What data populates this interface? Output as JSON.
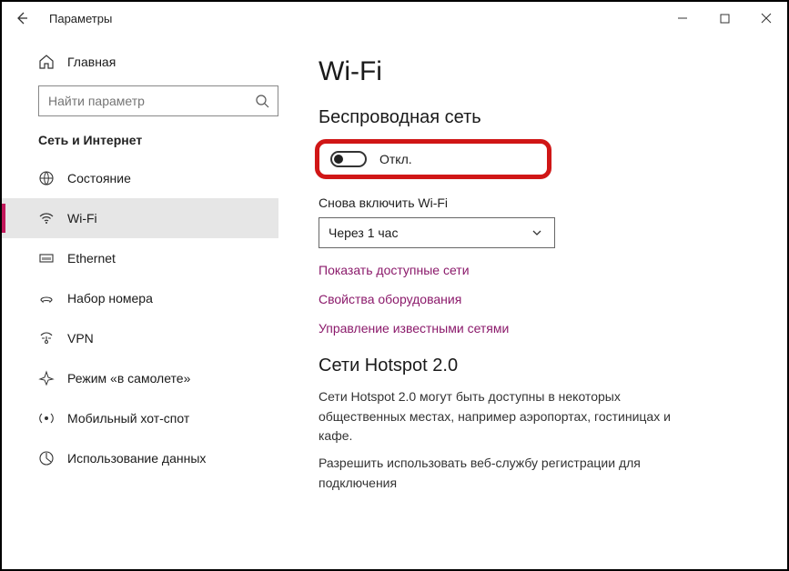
{
  "window": {
    "title": "Параметры"
  },
  "sidebar": {
    "home_label": "Главная",
    "search_placeholder": "Найти параметр",
    "category": "Сеть и Интернет",
    "items": [
      {
        "label": "Состояние"
      },
      {
        "label": "Wi-Fi"
      },
      {
        "label": "Ethernet"
      },
      {
        "label": "Набор номера"
      },
      {
        "label": "VPN"
      },
      {
        "label": "Режим «в самолете»"
      },
      {
        "label": "Мобильный хот-спот"
      },
      {
        "label": "Использование данных"
      }
    ]
  },
  "main": {
    "heading": "Wi-Fi",
    "wireless_heading": "Беспроводная сеть",
    "toggle_state": "Откл.",
    "reenable_label": "Снова включить Wi-Fi",
    "reenable_value": "Через 1 час",
    "links": {
      "available": "Показать доступные сети",
      "hardware": "Свойства оборудования",
      "known": "Управление известными сетями"
    },
    "hotspot_heading": "Сети Hotspot 2.0",
    "hotspot_desc": "Сети Hotspot 2.0 могут быть доступны в некоторых общественных местах, например аэропортах, гостиницах и кафе.",
    "hotspot_allow": "Разрешить использовать веб-службу регистрации для подключения"
  }
}
